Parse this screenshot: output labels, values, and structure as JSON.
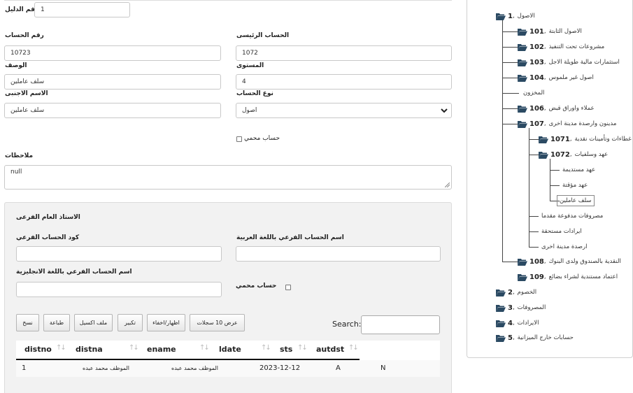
{
  "form": {
    "guide_no_label": "رقم الدليل",
    "guide_no_value": "1",
    "account_no_label": "رقم الحساب",
    "account_no_value": "10723",
    "main_account_label": "الحساب الرئيسى",
    "main_account_value": "1072",
    "description_label": "الوصف",
    "description_value": "سلف عاملين",
    "level_label": "المستوى",
    "level_value": "4",
    "foreign_name_label": "الاسم الاجنبى",
    "foreign_name_value": "سلف عاملين",
    "account_type_label": "نوع الحساب",
    "account_type_value": "اصول",
    "accountant_label": "حساب محمي",
    "notes_label": "ملاحظات",
    "notes_value": "null"
  },
  "sub_ledger": {
    "title": "الاستاذ العام الفرعى",
    "sub_code_label": "كود الحساب الفرعي",
    "sub_name_ar_label": "اسم الحساب الفرعي باللغة العربية",
    "sub_name_en_label": "اسم الحساب الفرعي باللغة الانجليزية",
    "accountant_label": "حساب محمي",
    "buttons": [
      "نسخ",
      "طباعة",
      "ملف اكسيل",
      "تكبير",
      "اظهار/اخفاء",
      "عرض 10 سجلات"
    ],
    "search_label": "Search:",
    "search_value": "",
    "table": {
      "columns": [
        "distno",
        "distna",
        "ename",
        "ldate",
        "sts",
        "autdst"
      ],
      "rows": [
        [
          "1",
          "الموظف محمد عبده",
          "الموظف محمد عبده",
          "2023-12-12",
          "A",
          "N"
        ]
      ]
    }
  },
  "tree": {
    "nodes": [
      {
        "code": "1",
        "name": "الاصول",
        "folder": true
      },
      {
        "code": "101",
        "name": "الاصول الثابتة",
        "folder": true
      },
      {
        "code": "102",
        "name": "مشروعات تحت التنفيذ",
        "folder": true
      },
      {
        "code": "103",
        "name": "استثمارات مالية طويلة الاجل",
        "folder": true
      },
      {
        "code": "104",
        "name": "اصول غير ملموس",
        "folder": true
      },
      {
        "code": "",
        "name": "المخزون",
        "folder": false
      },
      {
        "code": "106",
        "name": "عملاء واوراق قبض",
        "folder": true
      },
      {
        "code": "107",
        "name": "مدينون وارصدة مدينة اخرى",
        "folder": true
      },
      {
        "code": "1071",
        "name": "غطاءات وتأمينات نقدية",
        "folder": true
      },
      {
        "code": "1072",
        "name": "عهد وسلفيات",
        "folder": true
      },
      {
        "code": "",
        "name": "عهد مستديمة",
        "folder": false
      },
      {
        "code": "",
        "name": "عهد مؤقتة",
        "folder": false
      },
      {
        "code": "",
        "name": "سلف عاملين",
        "folder": false
      },
      {
        "code": "",
        "name": "مصروفات مدفوعة مقدما",
        "folder": false
      },
      {
        "code": "",
        "name": "ايرادات مستحقة",
        "folder": false
      },
      {
        "code": "",
        "name": "ارصدة مدينة اخرى",
        "folder": false
      },
      {
        "code": "108",
        "name": "النقدية بالصندوق ولدى البنوك",
        "folder": true
      },
      {
        "code": "109",
        "name": "اعتماد مستندية لشراء بضائع",
        "folder": true
      },
      {
        "code": "2",
        "name": "الخصوم",
        "folder": true
      },
      {
        "code": "3",
        "name": "المصروفات",
        "folder": true
      },
      {
        "code": "4",
        "name": "الايرادات",
        "folder": true
      },
      {
        "code": "5",
        "name": "حسابات خارج الميزانية",
        "folder": true
      }
    ]
  },
  "colors": {
    "folder": "#2b4a63",
    "panel": "#f2f2f2",
    "border": "#c8c8c8"
  }
}
